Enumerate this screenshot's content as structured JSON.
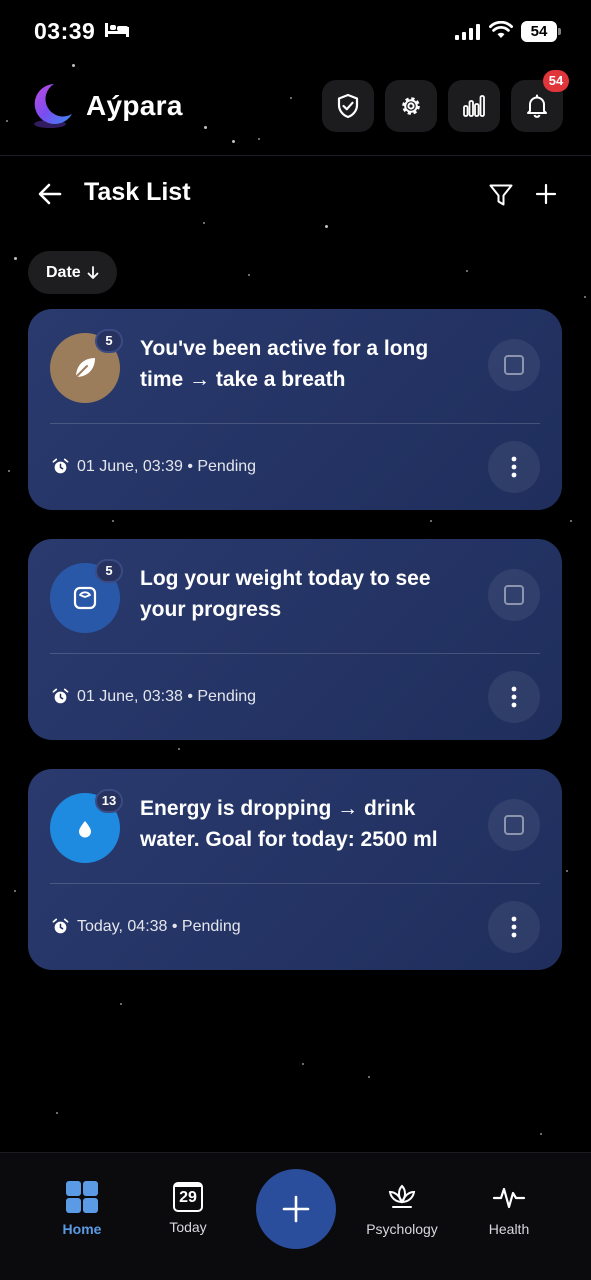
{
  "status_bar": {
    "time": "03:39",
    "battery_level": "54"
  },
  "app": {
    "brand_name": "Aýpara",
    "notification_count": "54"
  },
  "page": {
    "title": "Task List",
    "sort_label": "Date"
  },
  "tasks": [
    {
      "title": "You've been active for a long time → take a breath",
      "badge": "5",
      "meta": "01 June, 03:39 • Pending",
      "icon": "leaf-icon",
      "icon_color": "#9b7d5c"
    },
    {
      "title": "Log your weight today to see your progress",
      "badge": "5",
      "meta": "01 June, 03:38 • Pending",
      "icon": "scale-icon",
      "icon_color": "#2a58a8"
    },
    {
      "title": "Energy is dropping → drink water. Goal for today: 2500 ml",
      "badge": "13",
      "meta": "Today, 04:38 • Pending",
      "icon": "water-drop-icon",
      "icon_color": "#1e8ae0"
    }
  ],
  "bottom_nav": {
    "items": [
      {
        "label": "Home",
        "icon": "grid-icon",
        "active": true
      },
      {
        "label": "Today",
        "icon": "calendar-icon",
        "day": "29"
      },
      {
        "label": "Psychology",
        "icon": "lotus-icon"
      },
      {
        "label": "Health",
        "icon": "pulse-icon"
      }
    ]
  },
  "colors": {
    "background": "#000000",
    "card": "#25356a",
    "accent": "#2a4e9c",
    "active_nav": "#5b9be6",
    "badge_red": "#e0353a"
  }
}
